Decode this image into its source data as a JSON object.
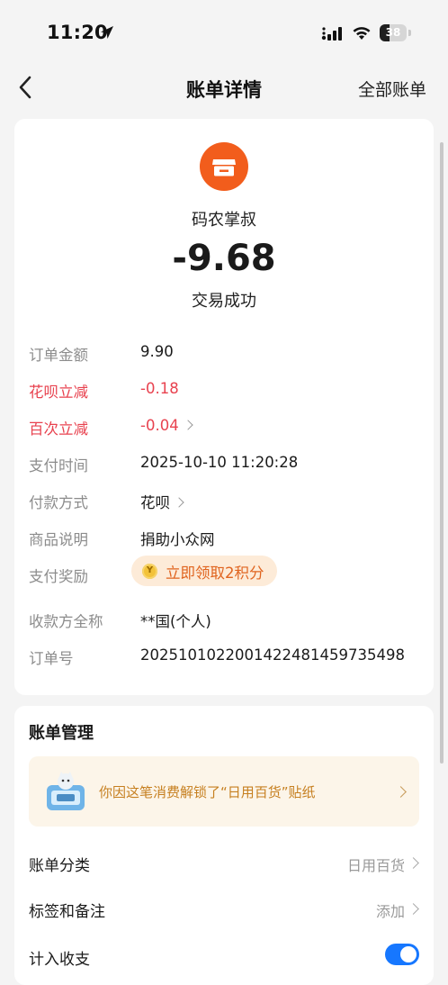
{
  "status_bar": {
    "time": "11:20",
    "battery": "38",
    "battery_level": 0.38
  },
  "nav": {
    "title": "账单详情",
    "right_action": "全部账单"
  },
  "summary": {
    "merchant": "码农掌叔",
    "amount": "-9.68",
    "status": "交易成功"
  },
  "details": [
    {
      "label": "订单金额",
      "value": "9.90"
    },
    {
      "label": "花呗立减",
      "value": "-0.18"
    },
    {
      "label": "百次立减",
      "value": "-0.04"
    },
    {
      "label": "支付时间",
      "value": "2025-10-10 11:20:28"
    },
    {
      "label": "付款方式",
      "value": "花呗"
    },
    {
      "label": "商品说明",
      "value": "捐助小众网"
    },
    {
      "label": "支付奖励",
      "value": "立即领取2积分",
      "coin_mark": "Y"
    },
    {
      "label": "收款方全称",
      "value": "**国(个人)"
    },
    {
      "label": "订单号",
      "value": "2025101022001422481459735498"
    }
  ],
  "manage": {
    "title": "账单管理",
    "sticker_text": "你因这笔消费解锁了“日用百货”贴纸",
    "rows": [
      {
        "label": "账单分类",
        "value": "日用百货"
      },
      {
        "label": "标签和备注",
        "value": "添加"
      },
      {
        "label": "计入收支",
        "toggle_on": true
      }
    ]
  },
  "colors": {
    "accent": "#1677ff",
    "merchant": "#f25d1c",
    "discount": "#e8424f",
    "reward": "#e0641f",
    "sticker_text": "#c67f1f"
  }
}
